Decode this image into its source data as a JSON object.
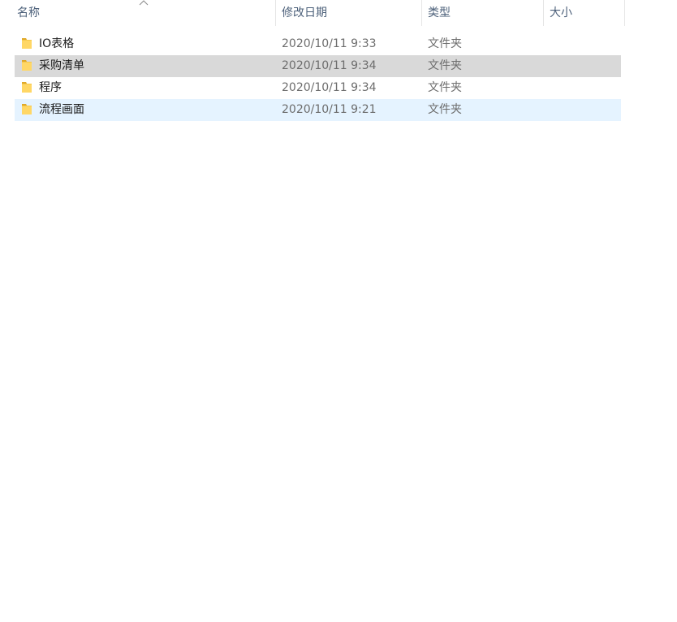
{
  "columns": {
    "name": "名称",
    "modified": "修改日期",
    "type": "类型",
    "size": "大小"
  },
  "sort": {
    "column": "name",
    "icon": "chevron-up-icon"
  },
  "files": [
    {
      "name": "IO表格",
      "modified": "2020/10/11 9:33",
      "type": "文件夹",
      "icon": "folder-icon",
      "state": "normal"
    },
    {
      "name": "采购清单",
      "modified": "2020/10/11 9:34",
      "type": "文件夹",
      "icon": "folder-icon",
      "state": "selected"
    },
    {
      "name": "程序",
      "modified": "2020/10/11 9:34",
      "type": "文件夹",
      "icon": "folder-icon",
      "state": "normal"
    },
    {
      "name": "流程画面",
      "modified": "2020/10/11 9:21",
      "type": "文件夹",
      "icon": "folder-icon",
      "state": "hover"
    }
  ],
  "colors": {
    "header_text": "#4c607a",
    "selected_row": "#d9d9d9",
    "hover_row": "#e5f3ff",
    "folder": "#f5c84c"
  }
}
